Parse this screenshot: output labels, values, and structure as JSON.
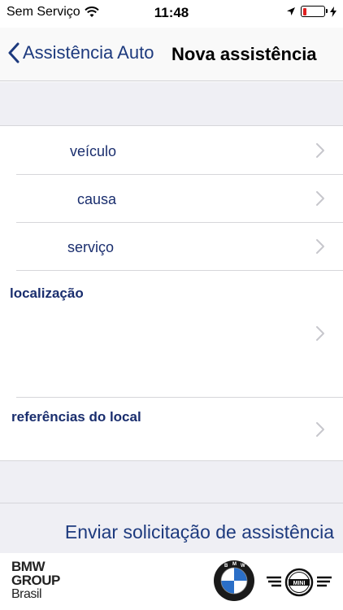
{
  "status_bar": {
    "carrier": "Sem Serviço",
    "time": "11:48",
    "icons": [
      "wifi-icon",
      "location-arrow-icon",
      "battery-icon",
      "charging-bolt-icon"
    ],
    "battery_level": 0.15
  },
  "nav": {
    "back_label": "Assistência Auto",
    "title": "Nova assistência"
  },
  "rows": {
    "vehicle": "veículo",
    "cause": "causa",
    "service": "serviço"
  },
  "sections": {
    "location": "localização",
    "references": "referências do local"
  },
  "submit_label": "Enviar solicitação de assistência",
  "footer": {
    "group_line1": "BMW",
    "group_line2": "GROUP",
    "group_line3": "Brasil",
    "logos": [
      "bmw-logo",
      "mini-logo"
    ]
  },
  "colors": {
    "accent": "#1d3a7e",
    "label": "#1a2e6e",
    "band": "#efeff4"
  }
}
